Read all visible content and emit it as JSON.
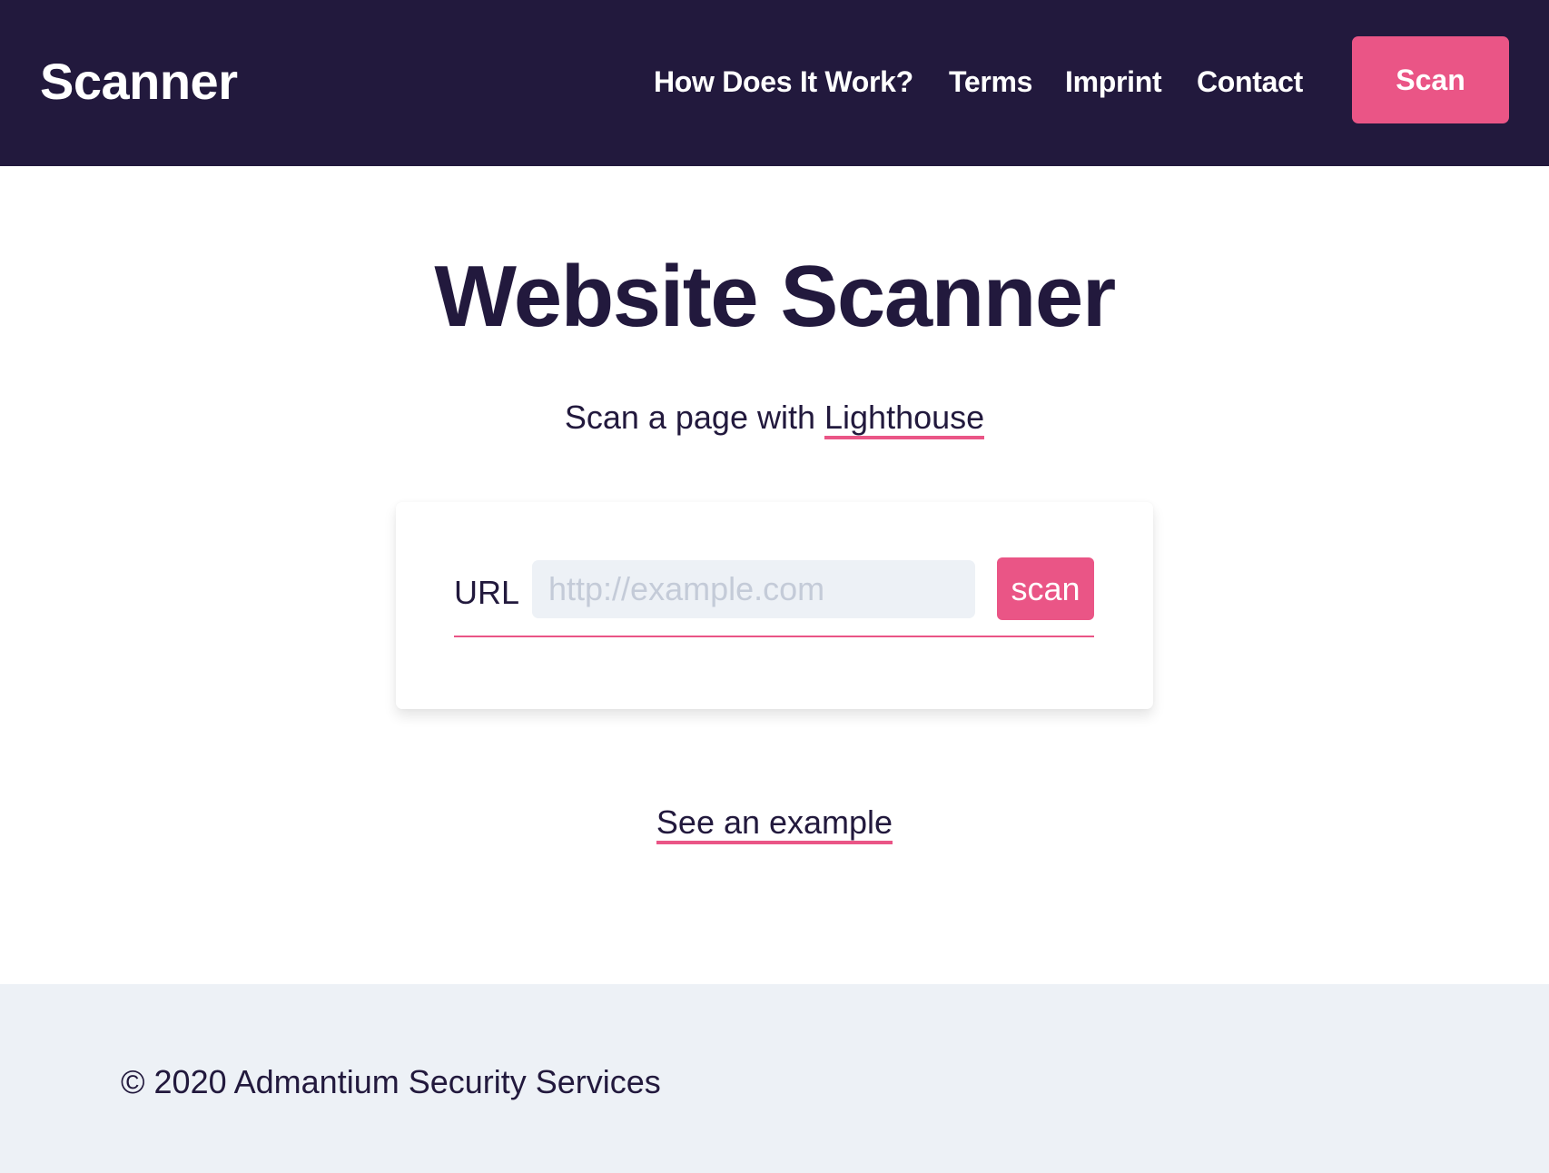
{
  "header": {
    "logo": "Scanner",
    "nav": [
      {
        "label": "How Does It Work?"
      },
      {
        "label": "Terms"
      },
      {
        "label": "Imprint"
      },
      {
        "label": "Contact"
      }
    ],
    "scan_button": "Scan"
  },
  "main": {
    "title": "Website Scanner",
    "subtitle_prefix": "Scan a page with ",
    "subtitle_link": "Lighthouse",
    "form": {
      "label": "URL",
      "input_value": "",
      "input_placeholder": "http://example.com",
      "submit_label": "scan"
    },
    "example_link": "See an example"
  },
  "footer": {
    "copyright": "© 2020 Admantium Security Services"
  },
  "colors": {
    "header_bg": "#22193d",
    "accent": "#ea5586",
    "text": "#22193d",
    "input_bg": "#edf1f6",
    "footer_bg": "#edf1f6"
  }
}
